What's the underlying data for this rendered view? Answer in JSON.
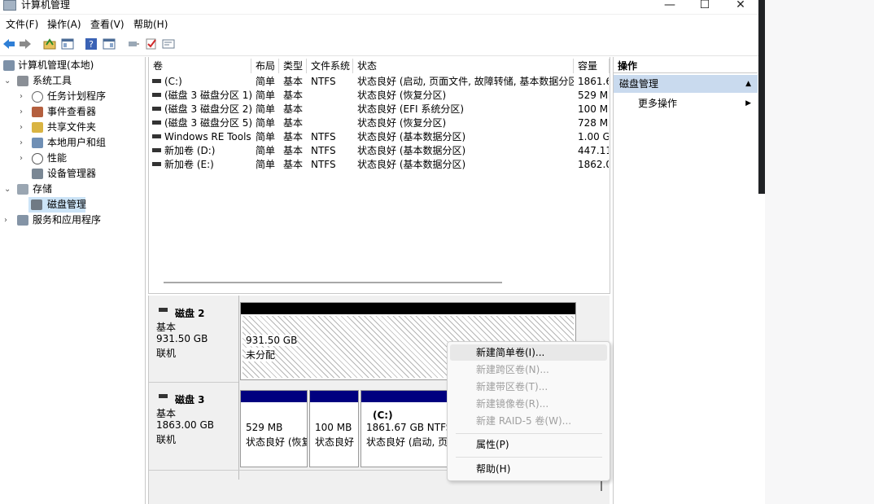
{
  "window": {
    "title": "计算机管理",
    "controls": {
      "minimize": "—",
      "maximize": "☐",
      "close": "✕"
    }
  },
  "menubar": [
    "文件(F)",
    "操作(A)",
    "查看(V)",
    "帮助(H)"
  ],
  "tree": {
    "root": "计算机管理(本地)",
    "system_tools": "系统工具",
    "task_scheduler": "任务计划程序",
    "event_viewer": "事件查看器",
    "shared_folders": "共享文件夹",
    "local_users": "本地用户和组",
    "performance": "性能",
    "device_manager": "设备管理器",
    "storage": "存储",
    "disk_management": "磁盘管理",
    "services_apps": "服务和应用程序"
  },
  "volumes": {
    "headers": [
      "卷",
      "布局",
      "类型",
      "文件系统",
      "状态",
      "容量"
    ],
    "rows": [
      {
        "name": "(C:)",
        "layout": "简单",
        "type": "基本",
        "fs": "NTFS",
        "status": "状态良好 (启动, 页面文件, 故障转储, 基本数据分区)",
        "size": "1861.6"
      },
      {
        "name": "(磁盘 3 磁盘分区 1)",
        "layout": "简单",
        "type": "基本",
        "fs": "",
        "status": "状态良好 (恢复分区)",
        "size": "529 MI"
      },
      {
        "name": "(磁盘 3 磁盘分区 2)",
        "layout": "简单",
        "type": "基本",
        "fs": "",
        "status": "状态良好 (EFI 系统分区)",
        "size": "100 MI"
      },
      {
        "name": "(磁盘 3 磁盘分区 5)",
        "layout": "简单",
        "type": "基本",
        "fs": "",
        "status": "状态良好 (恢复分区)",
        "size": "728 MI"
      },
      {
        "name": "Windows RE Tools",
        "layout": "简单",
        "type": "基本",
        "fs": "NTFS",
        "status": "状态良好 (基本数据分区)",
        "size": "1.00 GI"
      },
      {
        "name": "新加卷 (D:)",
        "layout": "简单",
        "type": "基本",
        "fs": "NTFS",
        "status": "状态良好 (基本数据分区)",
        "size": "447.11"
      },
      {
        "name": "新加卷 (E:)",
        "layout": "简单",
        "type": "基本",
        "fs": "NTFS",
        "status": "状态良好 (基本数据分区)",
        "size": "1862.0"
      }
    ]
  },
  "disks": {
    "disk2": {
      "name": "磁盘 2",
      "type": "基本",
      "size": "931.50 GB",
      "state": "联机",
      "part_size": "931.50 GB",
      "part_status": "未分配"
    },
    "disk3": {
      "name": "磁盘 3",
      "type": "基本",
      "size": "1863.00 GB",
      "state": "联机",
      "p1_size": "529 MB",
      "p1_status": "状态良好 (恢复",
      "p2_size": "100 MB",
      "p2_status": "状态良好",
      "p3_label": "(C:)",
      "p3_size": "1861.67 GB NTFS",
      "p3_status": "状态良好 (启动, 页面"
    }
  },
  "actions": {
    "header": "操作",
    "section": "磁盘管理",
    "more": "更多操作"
  },
  "context_menu": {
    "new_simple": "新建简单卷(I)...",
    "new_spanned": "新建跨区卷(N)...",
    "new_striped": "新建带区卷(T)...",
    "new_mirrored": "新建镜像卷(R)...",
    "new_raid5": "新建 RAID-5 卷(W)...",
    "properties": "属性(P)",
    "help": "帮助(H)"
  },
  "colors": {
    "unallocated_bar": "#000000",
    "primary_bar": "#00007f",
    "selection": "#cce4f7",
    "actions_header": "#c9daee"
  }
}
